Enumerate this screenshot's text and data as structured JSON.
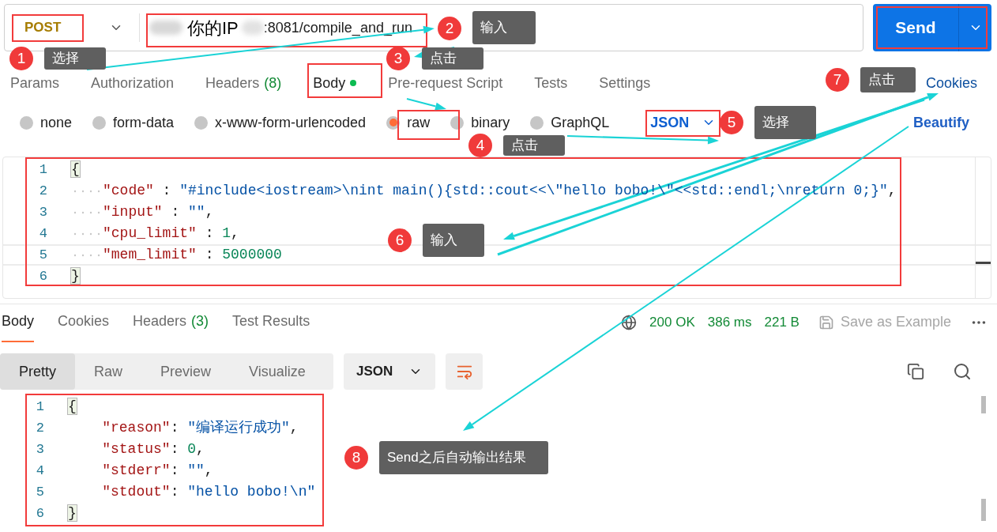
{
  "request": {
    "method": "POST",
    "ip_label": "你的IP",
    "url": ":8081/compile_and_run",
    "send": "Send"
  },
  "request_tabs": [
    {
      "label": "Params",
      "selected": false
    },
    {
      "label": "Authorization",
      "selected": false
    },
    {
      "label": "Headers",
      "count": "(8)",
      "selected": false
    },
    {
      "label": "Body",
      "selected": true,
      "indicator": true
    },
    {
      "label": "Pre-request Script",
      "selected": false
    },
    {
      "label": "Tests",
      "selected": false
    },
    {
      "label": "Settings",
      "selected": false
    }
  ],
  "cookies_link": "Cookies",
  "body_types": [
    {
      "label": "none",
      "selected": false
    },
    {
      "label": "form-data",
      "selected": false
    },
    {
      "label": "x-www-form-urlencoded",
      "selected": false
    },
    {
      "label": "raw",
      "selected": true
    },
    {
      "label": "binary",
      "selected": false
    },
    {
      "label": "GraphQL",
      "selected": false
    }
  ],
  "body_format": "JSON",
  "beautify": "Beautify",
  "request_editor": [
    {
      "number": "1",
      "indent": false,
      "current": false,
      "tokens": [
        {
          "kind": "bracket",
          "text": "{"
        }
      ]
    },
    {
      "number": "2",
      "indent": true,
      "current": false,
      "tokens": [
        {
          "kind": "key",
          "text": "\"code\""
        },
        {
          "kind": "punct",
          "text": " : "
        },
        {
          "kind": "string",
          "text": "\"#include<iostream>\\nint main(){std::cout<<\\\"hello bobo!\\\"<<std::endl;\\nreturn 0;}\""
        },
        {
          "kind": "punct",
          "text": ","
        }
      ]
    },
    {
      "number": "3",
      "indent": true,
      "current": false,
      "tokens": [
        {
          "kind": "key",
          "text": "\"input\""
        },
        {
          "kind": "punct",
          "text": " : "
        },
        {
          "kind": "string",
          "text": "\"\""
        },
        {
          "kind": "punct",
          "text": ","
        }
      ]
    },
    {
      "number": "4",
      "indent": true,
      "current": false,
      "tokens": [
        {
          "kind": "key",
          "text": "\"cpu_limit\""
        },
        {
          "kind": "punct",
          "text": " : "
        },
        {
          "kind": "number",
          "text": "1"
        },
        {
          "kind": "punct",
          "text": ","
        }
      ]
    },
    {
      "number": "5",
      "indent": true,
      "current": true,
      "tokens": [
        {
          "kind": "key",
          "text": "\"mem_limit\""
        },
        {
          "kind": "punct",
          "text": " : "
        },
        {
          "kind": "number",
          "text": "5000000"
        }
      ]
    },
    {
      "number": "6",
      "indent": false,
      "current": false,
      "tokens": [
        {
          "kind": "bracket",
          "text": "}"
        }
      ]
    }
  ],
  "response_tabs": [
    {
      "label": "Body",
      "selected": true
    },
    {
      "label": "Cookies",
      "selected": false
    },
    {
      "label": "Headers",
      "count": "(3)",
      "selected": false
    },
    {
      "label": "Test Results",
      "selected": false
    }
  ],
  "response_status": {
    "code": "200 OK",
    "time": "386 ms",
    "size": "221 B",
    "save": "Save as Example"
  },
  "view_modes": [
    {
      "label": "Pretty",
      "selected": true
    },
    {
      "label": "Raw",
      "selected": false
    },
    {
      "label": "Preview",
      "selected": false
    },
    {
      "label": "Visualize",
      "selected": false
    }
  ],
  "response_format": "JSON",
  "response_editor": [
    {
      "number": "1",
      "tokens": [
        {
          "kind": "bracket",
          "text": "{"
        }
      ]
    },
    {
      "number": "2",
      "tokens": [
        {
          "kind": "key",
          "text": "    \"reason\""
        },
        {
          "kind": "punct",
          "text": ": "
        },
        {
          "kind": "string",
          "text": "\"编译运行成功\""
        },
        {
          "kind": "punct",
          "text": ","
        }
      ]
    },
    {
      "number": "3",
      "tokens": [
        {
          "kind": "key",
          "text": "    \"status\""
        },
        {
          "kind": "punct",
          "text": ": "
        },
        {
          "kind": "number",
          "text": "0"
        },
        {
          "kind": "punct",
          "text": ","
        }
      ]
    },
    {
      "number": "4",
      "tokens": [
        {
          "kind": "key",
          "text": "    \"stderr\""
        },
        {
          "kind": "punct",
          "text": ": "
        },
        {
          "kind": "string",
          "text": "\"\""
        },
        {
          "kind": "punct",
          "text": ","
        }
      ]
    },
    {
      "number": "5",
      "tokens": [
        {
          "kind": "key",
          "text": "    \"stdout\""
        },
        {
          "kind": "punct",
          "text": ": "
        },
        {
          "kind": "string",
          "text": "\"hello bobo!\\n\""
        }
      ]
    },
    {
      "number": "6",
      "tokens": [
        {
          "kind": "bracket",
          "text": "}"
        }
      ]
    }
  ],
  "annotations": [
    {
      "number": "1",
      "label": "选择"
    },
    {
      "number": "2",
      "label": "输入"
    },
    {
      "number": "3",
      "label": "点击"
    },
    {
      "number": "4",
      "label": "点击"
    },
    {
      "number": "5",
      "label": "选择"
    },
    {
      "number": "6",
      "label": "输入"
    },
    {
      "number": "7",
      "label": "点击"
    },
    {
      "number": "8",
      "label": "Send之后自动输出结果"
    }
  ]
}
